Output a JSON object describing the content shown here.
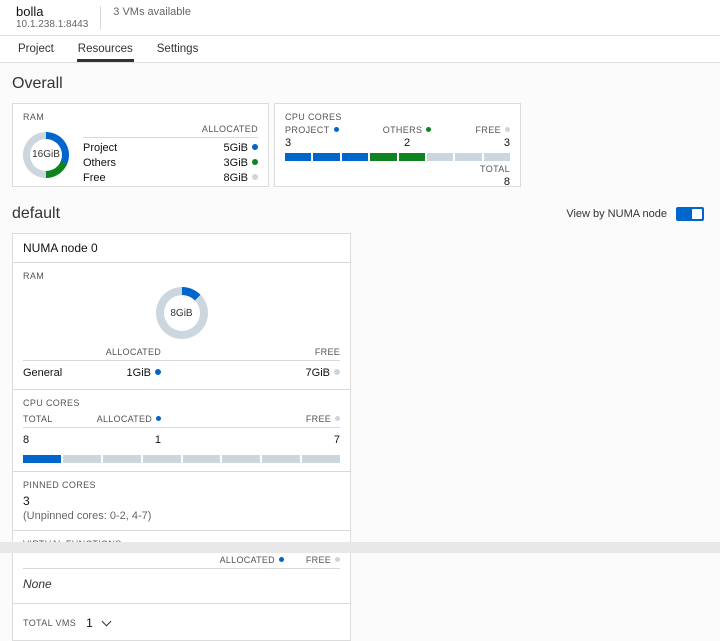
{
  "header": {
    "server_name": "bolla",
    "server_address": "10.1.238.1:8443",
    "vms_available": "3 VMs available"
  },
  "tabs": {
    "project": "Project",
    "resources": "Resources",
    "settings": "Settings"
  },
  "colors": {
    "project": "#0066cc",
    "others": "#0e8420",
    "free": "#ccd6df"
  },
  "overall": {
    "title": "Overall",
    "ram": {
      "label": "RAM",
      "total": "16GiB",
      "allocated_header": "ALLOCATED",
      "rows": [
        {
          "name": "Project",
          "value": "5GiB"
        },
        {
          "name": "Others",
          "value": "3GiB"
        },
        {
          "name": "Free",
          "value": "8GiB"
        }
      ]
    },
    "cpu": {
      "label": "CPU CORES",
      "project_header": "PROJECT",
      "others_header": "OTHERS",
      "free_header": "FREE",
      "project_value": "3",
      "others_value": "2",
      "free_value": "3",
      "total_label": "TOTAL",
      "total_value": "8"
    }
  },
  "default_section": {
    "title": "default",
    "toggle_label": "View by NUMA node",
    "numa_title": "NUMA node 0",
    "ram": {
      "label": "RAM",
      "total": "8GiB",
      "allocated_header": "ALLOCATED",
      "free_header": "FREE",
      "row": {
        "name": "General",
        "allocated": "1GiB",
        "free": "7GiB"
      }
    },
    "cpu": {
      "label": "CPU CORES",
      "total_header": "TOTAL",
      "allocated_header": "ALLOCATED",
      "free_header": "FREE",
      "total_value": "8",
      "allocated_value": "1",
      "free_value": "7"
    },
    "pinned": {
      "label": "PINNED CORES",
      "value": "3",
      "note": "(Unpinned cores: 0-2, 4-7)"
    },
    "virtual_functions": {
      "label": "VIRTUAL FUNCTIONS",
      "allocated_header": "ALLOCATED",
      "free_header": "FREE",
      "value": "None"
    },
    "total_vms": {
      "label": "TOTAL VMS",
      "value": "1"
    }
  },
  "charts": {
    "overall_ram_donut": {
      "segments": [
        {
          "value": 5,
          "color": "#0066cc"
        },
        {
          "value": 3,
          "color": "#0e8420"
        },
        {
          "value": 8,
          "color": "#ccd6df"
        }
      ]
    },
    "numa_ram_donut": {
      "segments": [
        {
          "value": 1,
          "color": "#0066cc"
        },
        {
          "value": 7,
          "color": "#ccd6df"
        }
      ]
    },
    "overall_cpu_bar": [
      "#0066cc",
      "#0066cc",
      "#0066cc",
      "#0e8420",
      "#0e8420",
      "#ccd6df",
      "#ccd6df",
      "#ccd6df"
    ],
    "numa_cpu_bar": [
      "#0066cc",
      "#ccd6df",
      "#ccd6df",
      "#ccd6df",
      "#ccd6df",
      "#ccd6df",
      "#ccd6df",
      "#ccd6df"
    ]
  }
}
